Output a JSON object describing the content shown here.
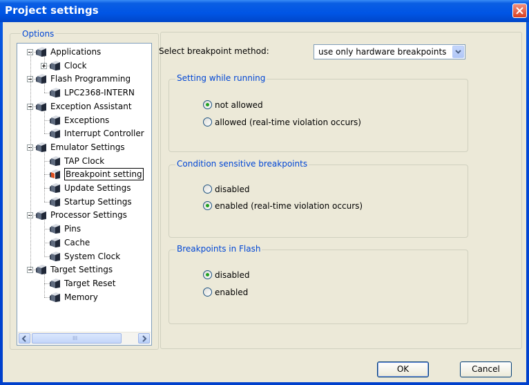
{
  "window": {
    "title": "Project settings"
  },
  "options": {
    "legend": "Options"
  },
  "tree": [
    {
      "label": "Applications",
      "level": 0,
      "expander": "minus"
    },
    {
      "label": "Clock",
      "level": 1,
      "expander": "plus"
    },
    {
      "label": "Flash Programming",
      "level": 0,
      "expander": "minus"
    },
    {
      "label": "LPC2368-INTERN",
      "level": 1
    },
    {
      "label": "Exception Assistant",
      "level": 0,
      "expander": "minus"
    },
    {
      "label": "Exceptions",
      "level": 1
    },
    {
      "label": "Interrupt Controller",
      "level": 1
    },
    {
      "label": "Emulator Settings",
      "level": 0,
      "expander": "minus"
    },
    {
      "label": "TAP Clock",
      "level": 1
    },
    {
      "label": "Breakpoint setting",
      "level": 1,
      "selected": true
    },
    {
      "label": "Update Settings",
      "level": 1
    },
    {
      "label": "Startup Settings",
      "level": 1
    },
    {
      "label": "Processor Settings",
      "level": 0,
      "expander": "minus"
    },
    {
      "label": "Pins",
      "level": 1
    },
    {
      "label": "Cache",
      "level": 1
    },
    {
      "label": "System Clock",
      "level": 1
    },
    {
      "label": "Target Settings",
      "level": 0,
      "expander": "minus"
    },
    {
      "label": "Target Reset",
      "level": 1
    },
    {
      "label": "Memory",
      "level": 1
    }
  ],
  "method": {
    "label": "Select breakpoint method:",
    "value": "use only hardware breakpoints"
  },
  "running": {
    "legend": "Setting while running",
    "options": [
      {
        "label": "not allowed",
        "checked": true
      },
      {
        "label": "allowed (real-time violation occurs)",
        "checked": false
      }
    ]
  },
  "condition": {
    "legend": "Condition sensitive breakpoints",
    "options": [
      {
        "label": "disabled",
        "checked": false
      },
      {
        "label": "enabled (real-time violation occurs)",
        "checked": true
      }
    ]
  },
  "flash": {
    "legend": "Breakpoints in Flash",
    "options": [
      {
        "label": "disabled",
        "checked": true
      },
      {
        "label": "enabled",
        "checked": false
      }
    ]
  },
  "buttons": {
    "ok": "OK",
    "cancel": "Cancel"
  },
  "scroll_grip": "III"
}
